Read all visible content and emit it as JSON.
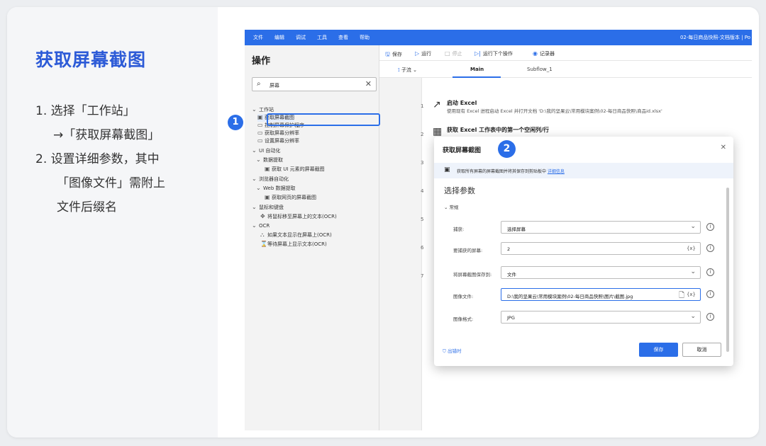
{
  "lesson": {
    "title": "获取屏幕截图",
    "steps": [
      "1. 选择「工作站」",
      "→「获取屏幕截图」",
      "2. 设置详细参数，其中",
      "「图像文件」需附上",
      "文件后缀名"
    ]
  },
  "app": {
    "menu": [
      "文件",
      "编辑",
      "调试",
      "工具",
      "查看",
      "帮助"
    ],
    "window_title": "02-每日商品快照-文档版本 | Po"
  },
  "actions_pane": {
    "title": "操作",
    "search_value": "屏幕",
    "tree": [
      {
        "label": "工作站",
        "glyph": "⌄"
      },
      {
        "label": "获取屏幕截图",
        "glyph": "▣"
      },
      {
        "label": "控制屏幕保护程序",
        "glyph": "▭"
      },
      {
        "label": "获取屏幕分辨率",
        "glyph": "▭"
      },
      {
        "label": "设置屏幕分辨率",
        "glyph": "▭"
      },
      {
        "label": "UI 自动化",
        "glyph": "⌄"
      },
      {
        "label": "数据提取",
        "glyph": "⌄"
      },
      {
        "label": "获取 UI 元素的屏幕截图",
        "glyph": "▣"
      },
      {
        "label": "浏览器自动化",
        "glyph": "⌄"
      },
      {
        "label": "Web 数据提取",
        "glyph": "⌄"
      },
      {
        "label": "获取网页的屏幕截图",
        "glyph": "▣"
      },
      {
        "label": "鼠标和键盘",
        "glyph": "⌄"
      },
      {
        "label": "将鼠标移至屏幕上的文本(OCR)",
        "glyph": "✥"
      },
      {
        "label": "OCR",
        "glyph": "⌄"
      },
      {
        "label": "如果文本显示在屏幕上(OCR)",
        "glyph": "⛬"
      },
      {
        "label": "等待屏幕上显示文本(OCR)",
        "glyph": "⌛"
      }
    ]
  },
  "toolbar": {
    "save": "保存",
    "run": "运行",
    "stop": "停止",
    "run_next": "运行下个操作",
    "recorder": "记录器"
  },
  "tabs": {
    "subflows": "子流",
    "main": "Main",
    "subflow1": "Subflow_1"
  },
  "flow": {
    "line_numbers": [
      "1",
      "2",
      "3",
      "4",
      "5",
      "6",
      "7"
    ],
    "step1_title": "启动 Excel",
    "step1_desc": "使用现有 Excel 进程启动 Excel 并打开文档 'D:\\我的坚果云\\常用模块案例\\02-每日商品快照\\商品id.xlsx'",
    "step2_title": "获取 Excel 工作表中的第一个空闲列/行"
  },
  "markers": {
    "one": "1",
    "two": "2"
  },
  "dialog": {
    "title": "获取屏幕截图",
    "info_text": "获取所有屏幕的屏幕截图并将其保存到剪贴板中 ",
    "info_link": "详细信息",
    "section": "选择参数",
    "group": "常规",
    "fields": [
      {
        "label": "捕获:",
        "value": "选择屏幕"
      },
      {
        "label": "要捕获的屏幕:",
        "value": "2"
      },
      {
        "label": "将屏幕截图保存到:",
        "value": "文件"
      },
      {
        "label": "图像文件:",
        "value": "D:\\我的坚果云\\常用模块案例\\02-每日商品快照\\图片\\截图.jpg"
      },
      {
        "label": "图像格式:",
        "value": "JPG"
      }
    ],
    "on_error": "出错时",
    "save": "保存",
    "cancel": "取消"
  }
}
